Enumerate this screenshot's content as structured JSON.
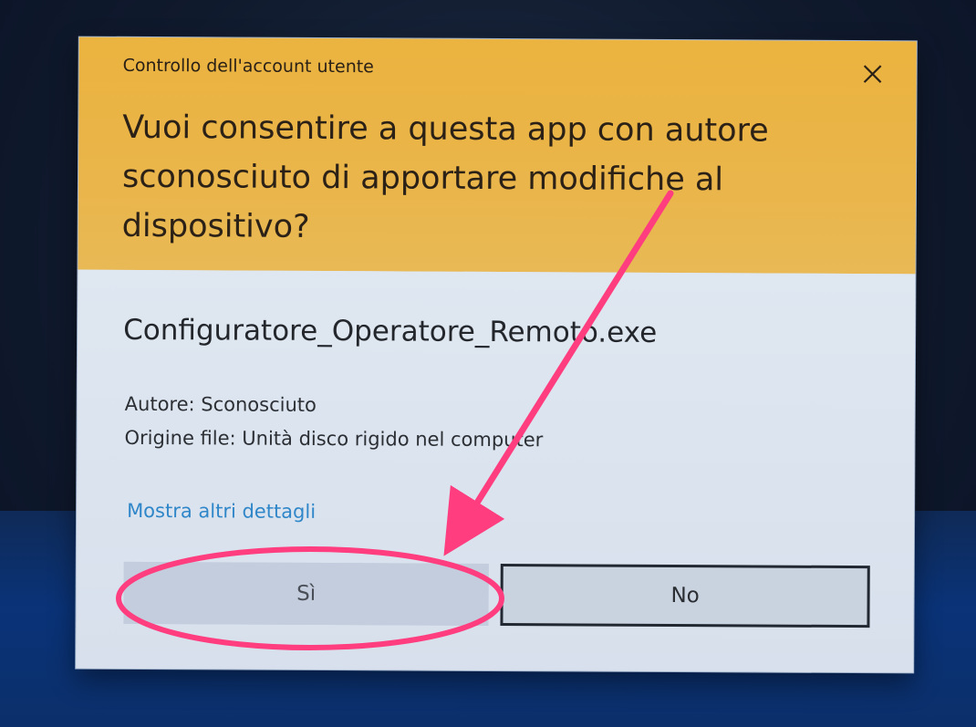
{
  "dialog": {
    "title": "Controllo dell'account utente",
    "question": "Vuoi consentire a questa app con autore sconosciuto di apportare modifiche al dispositivo?",
    "filename": "Configuratore_Operatore_Remoto.exe",
    "author": "Autore: Sconosciuto",
    "origin": "Origine file: Unità disco rigido nel computer",
    "details_link": "Mostra altri dettagli",
    "yes_label": "Sì",
    "no_label": "No",
    "close_icon": "close-icon"
  },
  "colors": {
    "header": "#ebb33f",
    "body": "#d8e0ec",
    "link": "#2f86c8",
    "annotation": "#ff3d7f"
  }
}
